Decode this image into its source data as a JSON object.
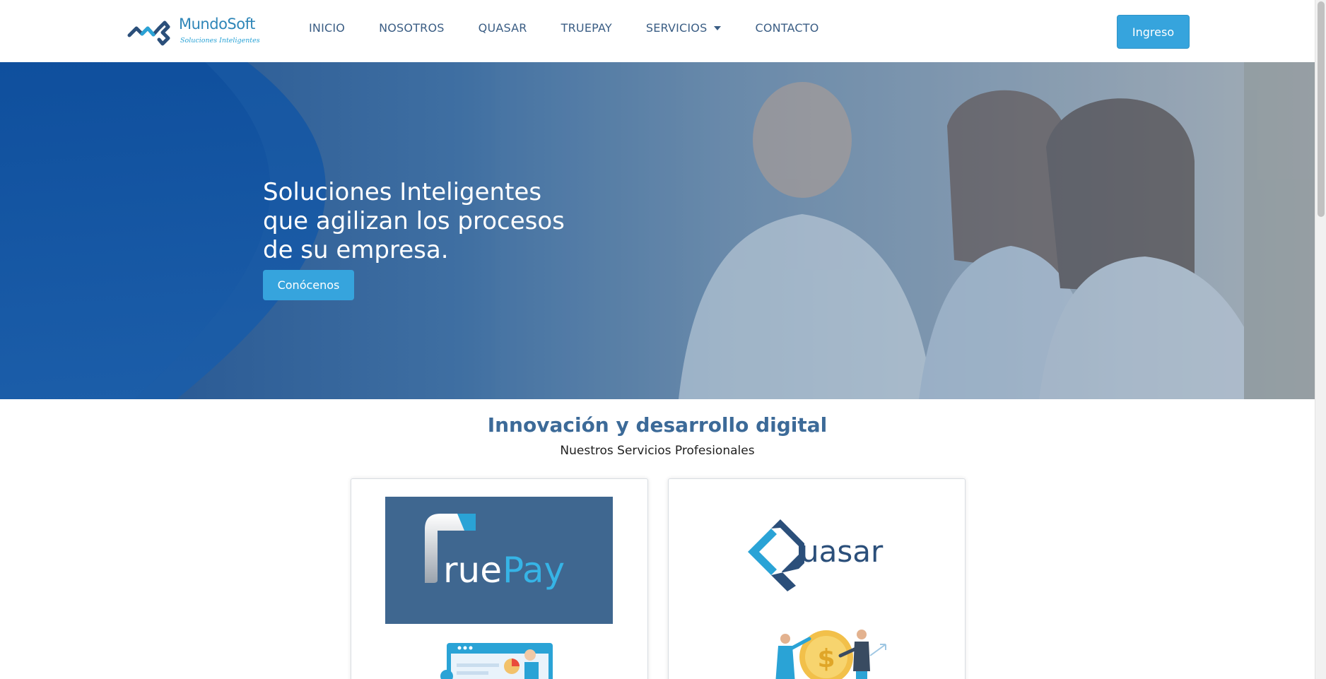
{
  "brand": {
    "name": "MundoSoft",
    "tagline": "Soluciones Inteligentes",
    "colors": {
      "primary": "#36a4dd",
      "navy": "#3a5d84",
      "heading": "#3c6a98"
    }
  },
  "nav": {
    "items": [
      {
        "label": "INICIO"
      },
      {
        "label": "NOSOTROS"
      },
      {
        "label": "QUASAR"
      },
      {
        "label": "TRUEPAY"
      },
      {
        "label": "SERVICIOS",
        "icon": "caret-down-icon"
      },
      {
        "label": "CONTACTO"
      }
    ],
    "login_label": "Ingreso"
  },
  "hero": {
    "title_lines": [
      "Soluciones Inteligentes",
      "que agilizan los procesos",
      "de su empresa."
    ],
    "cta_label": "Conócenos"
  },
  "services": {
    "title": "Innovación y desarrollo digital",
    "subtitle": "Nuestros Servicios Profesionales",
    "cards": [
      {
        "logo_text_a": "rue",
        "logo_text_b": "Pay",
        "illustration": "dashboard-illustration"
      },
      {
        "logo_text": "uasar",
        "illustration": "finance-people-illustration"
      }
    ]
  }
}
